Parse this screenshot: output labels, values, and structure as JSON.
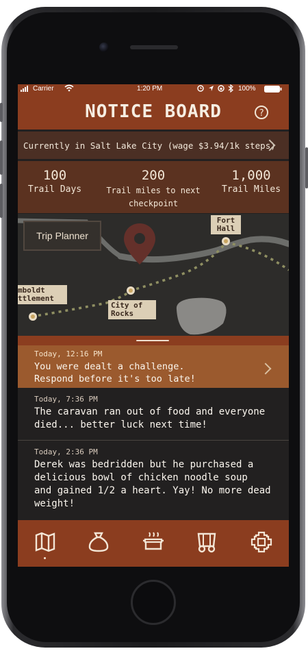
{
  "status": {
    "carrier": "Carrier",
    "time": "1:20 PM",
    "battery": "100%",
    "icons": [
      "signal-icon",
      "wifi-icon",
      "location-icon",
      "alarm-icon",
      "bluetooth-icon",
      "battery-icon"
    ]
  },
  "header": {
    "title": "NOTICE BOARD",
    "help_icon": "?"
  },
  "location": {
    "text": "Currently in Salt Lake City (wage $3.94/1k steps)"
  },
  "stats": [
    {
      "value": "100",
      "label": "Trail Days"
    },
    {
      "value": "200",
      "label_line1": "Trail miles to next",
      "label_line2": "checkpoint"
    },
    {
      "value": "1,000",
      "label": "Trail Miles"
    }
  ],
  "map": {
    "trip_planner_label": "Trip Planner",
    "labels": {
      "fort_hall": [
        "Fort",
        "Hall"
      ],
      "humboldt": [
        "mboldt",
        "ttlement"
      ],
      "city_of_rocks": [
        "City of",
        "Rocks"
      ]
    }
  },
  "feed": [
    {
      "time": "Today, 12:16 PM",
      "lines": [
        "You were dealt a challenge.",
        "Respond before it's too late!"
      ],
      "highlight": true
    },
    {
      "time": "Today, 7:36 PM",
      "lines": [
        "The caravan ran out of food and everyone",
        "died... better luck next time!"
      ],
      "highlight": false
    },
    {
      "time": "Today, 2:36 PM",
      "lines": [
        "Derek was bedridden but he purchased a",
        "delicious bowl of chicken noodle soup",
        "and gained 1/2 a heart. Yay! No more dead",
        "weight!"
      ],
      "highlight": false
    }
  ],
  "tabs": [
    "map-icon",
    "sack-icon",
    "cooking-pot-icon",
    "wagon-icon",
    "gear-icon"
  ],
  "colors": {
    "header": "#8b3d1f",
    "highlight": "#9b5a2e",
    "background": "#222020",
    "stats": "#5b3220"
  }
}
